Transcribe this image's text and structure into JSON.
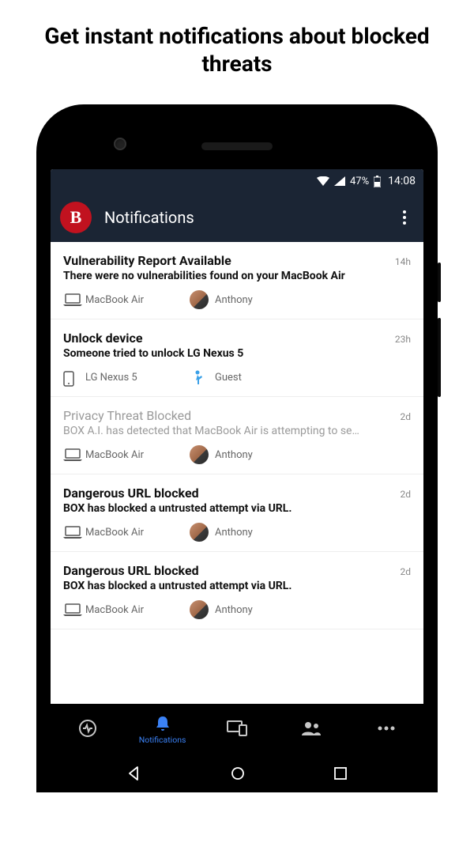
{
  "headline": "Get instant notifications about blocked threats",
  "statusbar": {
    "battery_pct": "47%",
    "time": "14:08"
  },
  "header": {
    "logo_letter": "B",
    "title": "Notifications"
  },
  "notifications": [
    {
      "title": "Vulnerability Report Available",
      "time": "14h",
      "body": "There were no vulnerabilities found on your MacBook Air",
      "device": "MacBook Air",
      "device_type": "laptop",
      "user": "Anthony",
      "user_type": "avatar",
      "read": false
    },
    {
      "title": "Unlock device",
      "time": "23h",
      "body": "Someone tried to unlock LG Nexus 5",
      "device": "LG Nexus 5",
      "device_type": "phone",
      "user": "Guest",
      "user_type": "guest",
      "read": false
    },
    {
      "title": "Privacy Threat Blocked",
      "time": "2d",
      "body": "BOX A.I. has detected that MacBook Air is attempting to se…",
      "device": "MacBook Air",
      "device_type": "laptop",
      "user": "Anthony",
      "user_type": "avatar",
      "read": true
    },
    {
      "title": "Dangerous URL blocked",
      "time": "2d",
      "body": "BOX has blocked a untrusted attempt via URL.",
      "device": "MacBook Air",
      "device_type": "laptop",
      "user": "Anthony",
      "user_type": "avatar",
      "read": false
    },
    {
      "title": "Dangerous URL blocked",
      "time": "2d",
      "body": "BOX has blocked a untrusted attempt via URL.",
      "device": "MacBook Air",
      "device_type": "laptop",
      "user": "Anthony",
      "user_type": "avatar",
      "read": false
    }
  ],
  "tabs": {
    "active_index": 1,
    "items": [
      {
        "name": "activity",
        "label": ""
      },
      {
        "name": "notifications",
        "label": "Notifications"
      },
      {
        "name": "devices",
        "label": ""
      },
      {
        "name": "users",
        "label": ""
      },
      {
        "name": "more",
        "label": ""
      }
    ]
  }
}
